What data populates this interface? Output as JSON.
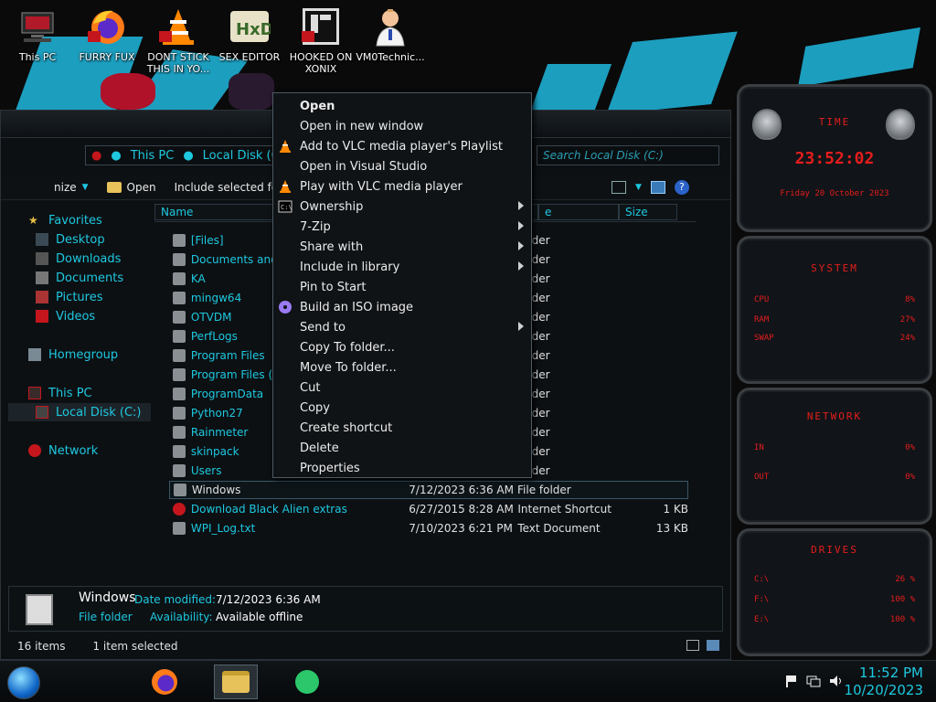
{
  "desktop": {
    "icons": [
      {
        "label": "This PC",
        "icon": "computer-icon"
      },
      {
        "label": "FURRY FUX",
        "icon": "firefox-icon"
      },
      {
        "label": "DONT STICK THIS IN YO...",
        "icon": "vlc-icon"
      },
      {
        "label": "SEX EDITOR",
        "icon": "hxd-icon"
      },
      {
        "label": "HOOKED ON XONIX",
        "icon": "game-icon"
      },
      {
        "label": "VM0Technic...",
        "icon": "doctor-icon"
      }
    ]
  },
  "explorer": {
    "breadcrumb": [
      "This PC",
      "Local Disk (C"
    ],
    "search_placeholder": "Search Local Disk (C:)",
    "toolbar": {
      "organize": "nize",
      "open": "Open",
      "include": "Include selected fol"
    },
    "nav": [
      {
        "label": "Favorites"
      },
      {
        "label": "Desktop"
      },
      {
        "label": "Downloads"
      },
      {
        "label": "Documents"
      },
      {
        "label": "Pictures"
      },
      {
        "label": "Videos"
      },
      {
        "label": "Homegroup"
      },
      {
        "label": "This PC"
      },
      {
        "label": "Local Disk (C:)"
      },
      {
        "label": "Network"
      }
    ],
    "columns": {
      "name": "Name",
      "type": "e",
      "size": "Size"
    },
    "rows": [
      {
        "name": "[Files]",
        "date": "",
        "type": "folder",
        "size": ""
      },
      {
        "name": "Documents and Se",
        "date": "",
        "type": "folder",
        "size": ""
      },
      {
        "name": "KA",
        "date": "",
        "type": "folder",
        "size": ""
      },
      {
        "name": "mingw64",
        "date": "",
        "type": "folder",
        "size": ""
      },
      {
        "name": "OTVDM",
        "date": "",
        "type": "folder",
        "size": ""
      },
      {
        "name": "PerfLogs",
        "date": "",
        "type": "folder",
        "size": ""
      },
      {
        "name": "Program Files",
        "date": "",
        "type": "folder",
        "size": ""
      },
      {
        "name": "Program Files (x8",
        "date": "",
        "type": "folder",
        "size": ""
      },
      {
        "name": "ProgramData",
        "date": "",
        "type": "folder",
        "size": ""
      },
      {
        "name": "Python27",
        "date": "",
        "type": "folder",
        "size": ""
      },
      {
        "name": "Rainmeter",
        "date": "",
        "type": "folder",
        "size": ""
      },
      {
        "name": "skinpack",
        "date": "",
        "type": "folder",
        "size": ""
      },
      {
        "name": "Users",
        "date": "",
        "type": "folder",
        "size": ""
      },
      {
        "name": "Windows",
        "date": "7/12/2023 6:36 AM",
        "type": "File folder",
        "size": ""
      },
      {
        "name": "Download Black Alien extras",
        "date": "6/27/2015 8:28 AM",
        "type": "Internet Shortcut",
        "size": "1 KB"
      },
      {
        "name": "WPI_Log.txt",
        "date": "7/10/2023 6:21 PM",
        "type": "Text Document",
        "size": "13 KB"
      }
    ],
    "details": {
      "name": "Windows",
      "date_label": "Date modified:",
      "date_value": "7/12/2023 6:36 AM",
      "type": "File folder",
      "avail_label": "Availability:",
      "avail_value": "Available offline"
    },
    "status": {
      "count": "16 items",
      "selected": "1 item selected"
    }
  },
  "context_menu": {
    "items": [
      {
        "label": "Open",
        "bold": true,
        "submenu": false,
        "icon": ""
      },
      {
        "label": "Open in new window",
        "bold": false,
        "submenu": false,
        "icon": ""
      },
      {
        "label": "Add to VLC media player's Playlist",
        "bold": false,
        "submenu": false,
        "icon": "vlc-icon"
      },
      {
        "label": "Open in Visual Studio",
        "bold": false,
        "submenu": false,
        "icon": ""
      },
      {
        "label": "Play with VLC media player",
        "bold": false,
        "submenu": false,
        "icon": "vlc-icon"
      },
      {
        "label": "Ownership",
        "bold": false,
        "submenu": true,
        "icon": "cmd-icon"
      },
      {
        "label": "7-Zip",
        "bold": false,
        "submenu": true,
        "icon": ""
      },
      {
        "label": "Share with",
        "bold": false,
        "submenu": true,
        "icon": ""
      },
      {
        "label": "Include in library",
        "bold": false,
        "submenu": true,
        "icon": ""
      },
      {
        "label": "Pin to Start",
        "bold": false,
        "submenu": false,
        "icon": ""
      },
      {
        "label": "Build an ISO image",
        "bold": false,
        "submenu": false,
        "icon": "disc-icon"
      },
      {
        "label": "Send to",
        "bold": false,
        "submenu": true,
        "icon": ""
      },
      {
        "label": "Copy To folder...",
        "bold": false,
        "submenu": false,
        "icon": ""
      },
      {
        "label": "Move To folder...",
        "bold": false,
        "submenu": false,
        "icon": ""
      },
      {
        "label": "Cut",
        "bold": false,
        "submenu": false,
        "icon": ""
      },
      {
        "label": "Copy",
        "bold": false,
        "submenu": false,
        "icon": ""
      },
      {
        "label": "Create shortcut",
        "bold": false,
        "submenu": false,
        "icon": ""
      },
      {
        "label": "Delete",
        "bold": false,
        "submenu": false,
        "icon": ""
      },
      {
        "label": "Properties",
        "bold": false,
        "submenu": false,
        "icon": ""
      }
    ]
  },
  "gadgets": {
    "time": {
      "title": "TIME",
      "clock": "23:52:02",
      "date": "Friday 20 October 2023"
    },
    "system": {
      "title": "SYSTEM",
      "rows": [
        {
          "label": "CPU",
          "value": "8%"
        },
        {
          "label": "RAM",
          "value": "27%"
        },
        {
          "label": "SWAP",
          "value": "24%"
        }
      ]
    },
    "network": {
      "title": "NETWORK",
      "rows": [
        {
          "label": "IN",
          "value": "0%"
        },
        {
          "label": "OUT",
          "value": "0%"
        }
      ]
    },
    "drives": {
      "title": "DRIVES",
      "rows": [
        {
          "label": "C:\\",
          "value": "26 %"
        },
        {
          "label": "F:\\",
          "value": "100 %"
        },
        {
          "label": "E:\\",
          "value": "100 %"
        }
      ]
    }
  },
  "taskbar": {
    "time": "11:52 PM",
    "date": "10/20/2023"
  },
  "colors": {
    "accent": "#1ec8e0",
    "gadget_red": "#e51d1d",
    "paint_blue": "#1ea7c9"
  }
}
